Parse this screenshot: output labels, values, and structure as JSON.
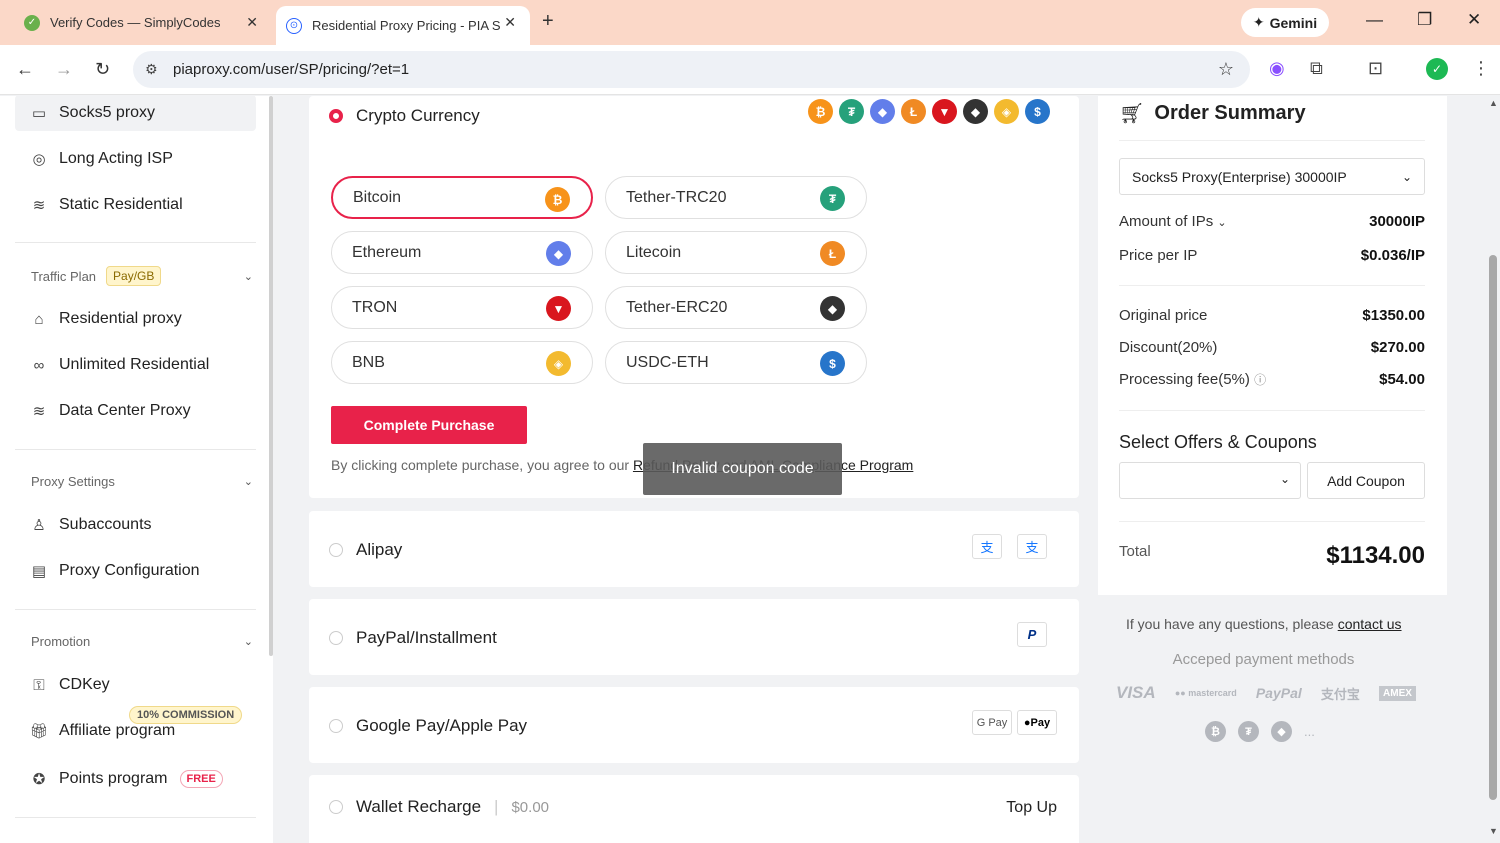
{
  "browser": {
    "tab1_title": "Verify Codes — SimplyCodes",
    "tab2_title": "Residential Proxy Pricing - PIA S",
    "gemini_label": "Gemini",
    "url": "piaproxy.com/user/SP/pricing/?et=1"
  },
  "sidebar": {
    "top_items": [
      {
        "label": "Socks5 proxy",
        "icon": "monitor-icon"
      },
      {
        "label": "Long Acting ISP",
        "icon": "globe-icon"
      },
      {
        "label": "Static Residential",
        "icon": "database-icon"
      }
    ],
    "traffic_plan": {
      "title": "Traffic Plan",
      "badge": "Pay/GB"
    },
    "traffic_items": [
      {
        "label": "Residential proxy",
        "icon": "bank-icon"
      },
      {
        "label": "Unlimited Residential",
        "icon": "infinity-icon"
      },
      {
        "label": "Data Center Proxy",
        "icon": "database-icon"
      }
    ],
    "proxy_settings": {
      "title": "Proxy Settings"
    },
    "settings_items": [
      {
        "label": "Subaccounts",
        "icon": "user-icon"
      },
      {
        "label": "Proxy Configuration",
        "icon": "file-icon"
      }
    ],
    "promotion": {
      "title": "Promotion"
    },
    "promotion_items": [
      {
        "label": "CDKey",
        "icon": "key-icon"
      },
      {
        "label": "Affiliate program",
        "icon": "gift-icon",
        "badge": "10% COMMISSION"
      },
      {
        "label": "Points program",
        "icon": "star-icon",
        "badge": "FREE"
      }
    ]
  },
  "payment": {
    "crypto_label": "Crypto Currency",
    "options": [
      {
        "label": "Bitcoin",
        "color": "#f7931a",
        "glyph": "₿"
      },
      {
        "label": "Tether-TRC20",
        "color": "#26a17b",
        "glyph": "₮"
      },
      {
        "label": "Ethereum",
        "color": "#627eea",
        "glyph": "◆"
      },
      {
        "label": "Litecoin",
        "color": "#f08a24",
        "glyph": "Ł"
      },
      {
        "label": "TRON",
        "color": "#d9161e",
        "glyph": "▼"
      },
      {
        "label": "Tether-ERC20",
        "color": "#333333",
        "glyph": "◆"
      },
      {
        "label": "BNB",
        "color": "#f3ba2f",
        "glyph": "◈"
      },
      {
        "label": "USDC-ETH",
        "color": "#2775ca",
        "glyph": "$"
      }
    ],
    "complete_purchase": "Complete Purchase",
    "agree_text": "By clicking complete purchase, you agree to our",
    "agree_link": "Refund Policy and AML Compliance Program",
    "toast": "Invalid coupon code",
    "alipay": "Alipay",
    "paypal": "PayPal/Installment",
    "google_apple": "Google Pay/Apple Pay",
    "gpay_label": "G Pay",
    "applepay_label": "Pay",
    "wallet": "Wallet Recharge",
    "wallet_amount": "$0.00",
    "top_up": "Top Up"
  },
  "order": {
    "title": "Order Summary",
    "product": "Socks5 Proxy(Enterprise) 30000IP",
    "amount_label": "Amount of IPs",
    "amount_value": "30000IP",
    "price_label": "Price per IP",
    "price_value": "$0.036/IP",
    "original_label": "Original price",
    "original_value": "$1350.00",
    "discount_label": "Discount(20%)",
    "discount_value": "$270.00",
    "fee_label": "Processing fee(5%)",
    "fee_value": "$54.00",
    "offers_title": "Select Offers & Coupons",
    "add_coupon": "Add Coupon",
    "total_label": "Total",
    "total_value": "$1134.00",
    "questions_text": "If you have any questions, please",
    "contact_link": "contact us",
    "accepted_title": "Acceped payment methods",
    "methods": [
      "VISA",
      "mastercard",
      "PayPal",
      "支付宝",
      "AMEX"
    ],
    "more": "..."
  },
  "colors": {
    "accent": "#e8224a"
  }
}
